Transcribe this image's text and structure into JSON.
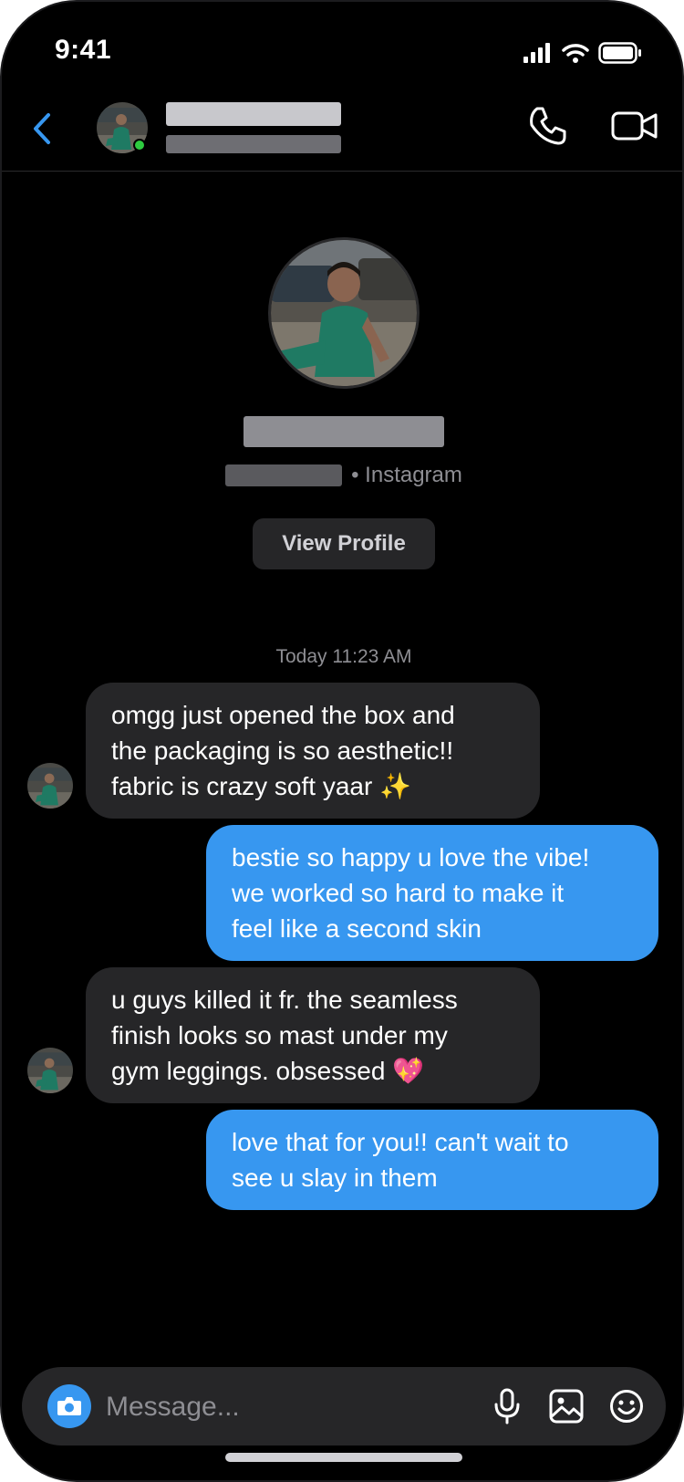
{
  "status_bar": {
    "time": "9:41"
  },
  "header": {
    "back_icon": "chevron-left-icon",
    "call_icon": "phone-icon",
    "video_icon": "video-camera-icon",
    "accent_color": "#3797f0",
    "online_color": "#2ecc40"
  },
  "profile": {
    "platform_text": "• Instagram",
    "view_profile_label": "View Profile"
  },
  "conversation": {
    "timestamp": "Today 11:23 AM",
    "messages": [
      {
        "direction": "incoming",
        "lines": [
          "omgg just opened the box and",
          "the packaging is so aesthetic!!",
          "fabric is crazy soft yaar ✨"
        ]
      },
      {
        "direction": "outgoing",
        "lines": [
          "bestie so happy u love the vibe!",
          "we worked so hard to make it",
          "feel like a second skin"
        ]
      },
      {
        "direction": "incoming",
        "lines": [
          "u guys killed it fr. the seamless",
          "finish looks so mast under my",
          "gym leggings. obsessed 💖"
        ]
      },
      {
        "direction": "outgoing",
        "lines": [
          "love that for you!! can't wait to",
          "see u slay in them"
        ]
      }
    ]
  },
  "composer": {
    "placeholder": "Message...",
    "camera_icon": "camera-icon",
    "mic_icon": "microphone-icon",
    "gallery_icon": "image-icon",
    "sticker_icon": "smiley-icon"
  }
}
